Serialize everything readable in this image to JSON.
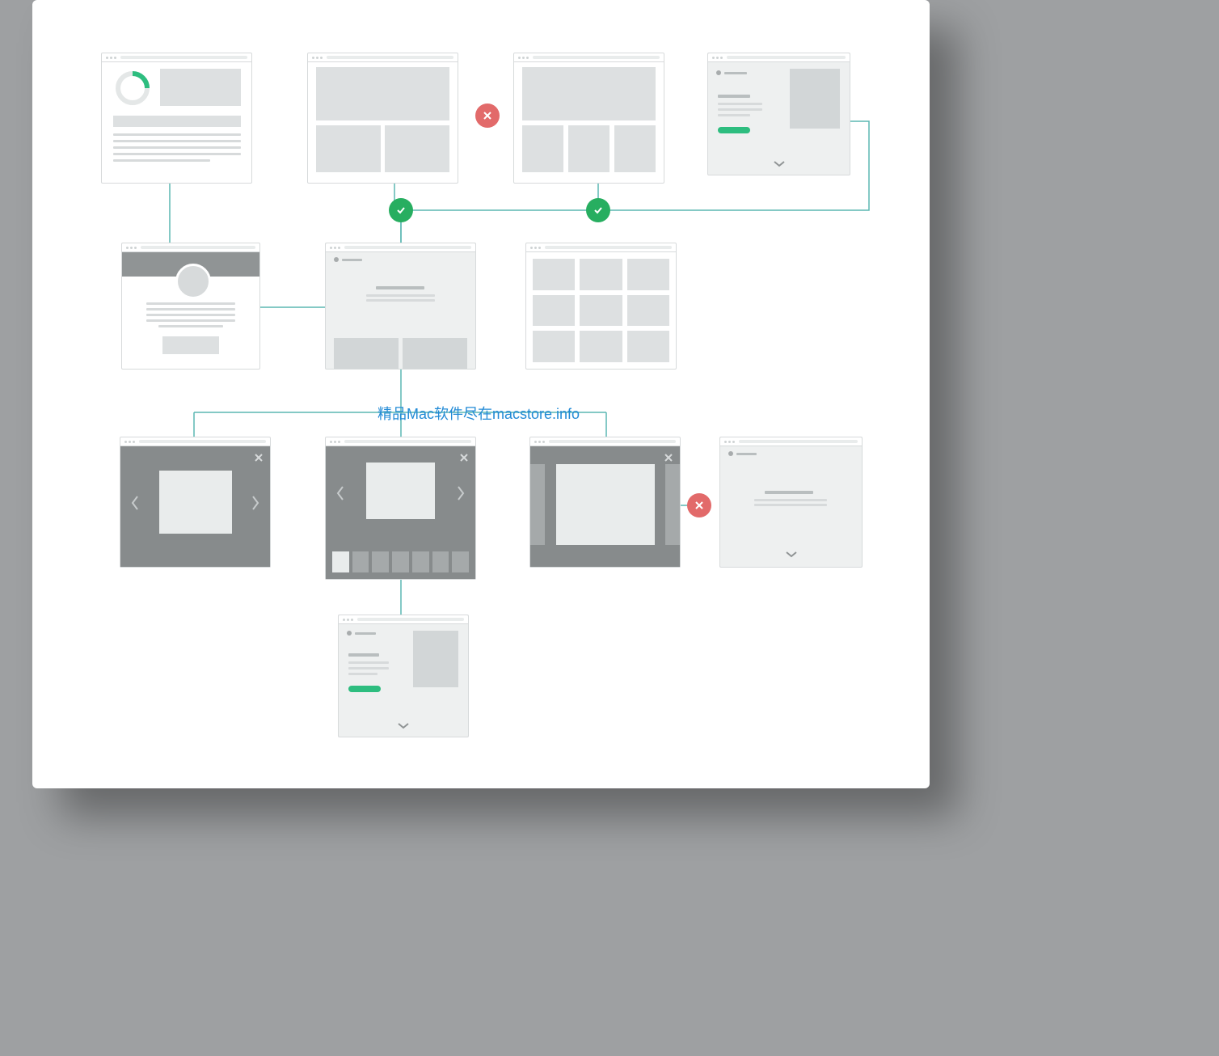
{
  "watermark": "精品Mac软件尽在macstore.info",
  "nodes": {
    "row1": [
      "dashboard-wireframe",
      "gallery-wireframe-a",
      "gallery-wireframe-b",
      "product-card-wireframe"
    ],
    "row2": [
      "profile-wireframe",
      "article-wireframe",
      "grid-wireframe"
    ],
    "row3": [
      "lightbox-simple",
      "lightbox-thumbs",
      "lightbox-slider",
      "text-page-wireframe"
    ],
    "row4": [
      "product-card-wireframe-b"
    ]
  },
  "badges": [
    {
      "type": "no",
      "between": [
        "gallery-wireframe-a",
        "gallery-wireframe-b"
      ]
    },
    {
      "type": "ok",
      "on": "article-wireframe-top-left"
    },
    {
      "type": "ok",
      "on": "article-wireframe-top-right"
    },
    {
      "type": "no",
      "between": [
        "lightbox-slider",
        "text-page-wireframe"
      ]
    }
  ],
  "colors": {
    "connector": "#5bb7b2",
    "ok": "#27ae60",
    "no": "#e26a6a",
    "accent": "#2dbd7f",
    "watermark": "#238bd6"
  }
}
